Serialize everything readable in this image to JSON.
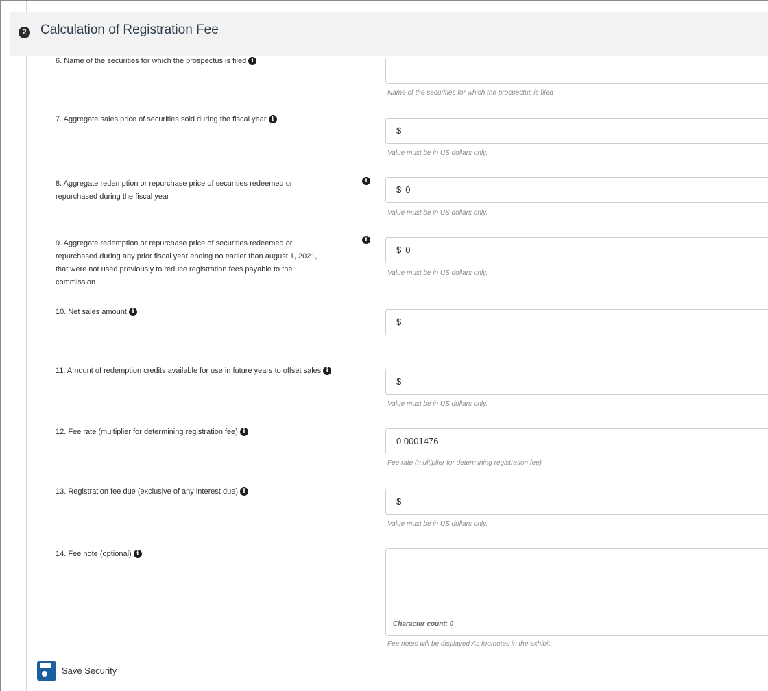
{
  "section": {
    "step": "2",
    "title": "Calculation of Registration Fee"
  },
  "info_icon_glyph": "i",
  "fields": [
    {
      "label": "6. Name of the securities for which the prospectus is filed",
      "prefix": "",
      "value": "",
      "help": "Name of the securities for which the prospectus is filed"
    },
    {
      "label": "7. Aggregate sales price of securities sold during the fiscal year",
      "prefix": "$",
      "value": "",
      "help": "Value must be in US dollars only."
    },
    {
      "label_lines": [
        "8. Aggregate redemption or repurchase price of securities redeemed or",
        "repurchased during the fiscal year"
      ],
      "prefix": "$",
      "value": "0",
      "help": "Value must be in US dollars only."
    },
    {
      "label_lines": [
        "9. Aggregate redemption or repurchase price of securities redeemed or",
        "repurchased during any prior fiscal year ending no earlier than august 1, 2021,",
        "that were not used previously to reduce registration fees payable to the",
        "commission"
      ],
      "prefix": "$",
      "value": "0",
      "help": "Value must be in US dollars only."
    },
    {
      "label": "10. Net sales amount",
      "prefix": "$",
      "value": "",
      "help": ""
    },
    {
      "label": "11. Amount of redemption credits available for use in future years to offset sales",
      "prefix": "$",
      "value": "",
      "help": "Value must be in US dollars only."
    },
    {
      "label": "12. Fee rate (multiplier for determining registration fee)",
      "prefix": "",
      "value": "0.0001476",
      "help": "Fee rate (multiplier for determining registration fee)"
    },
    {
      "label": "13. Registration fee due (exclusive of any interest due)",
      "prefix": "$",
      "value": "",
      "help": "Value must be in US dollars only."
    },
    {
      "label": "14. Fee note (optional)",
      "char_count": "Character count: 0",
      "help": "Fee notes will be displayed As footnotes in the exhibit."
    }
  ],
  "save_button": {
    "label": "Save Security",
    "icon": "floppy-disk-icon"
  },
  "colors": {
    "accent": "#1a5fa0",
    "header_bg": "#f2f2f2",
    "title": "#2b3a4b"
  }
}
